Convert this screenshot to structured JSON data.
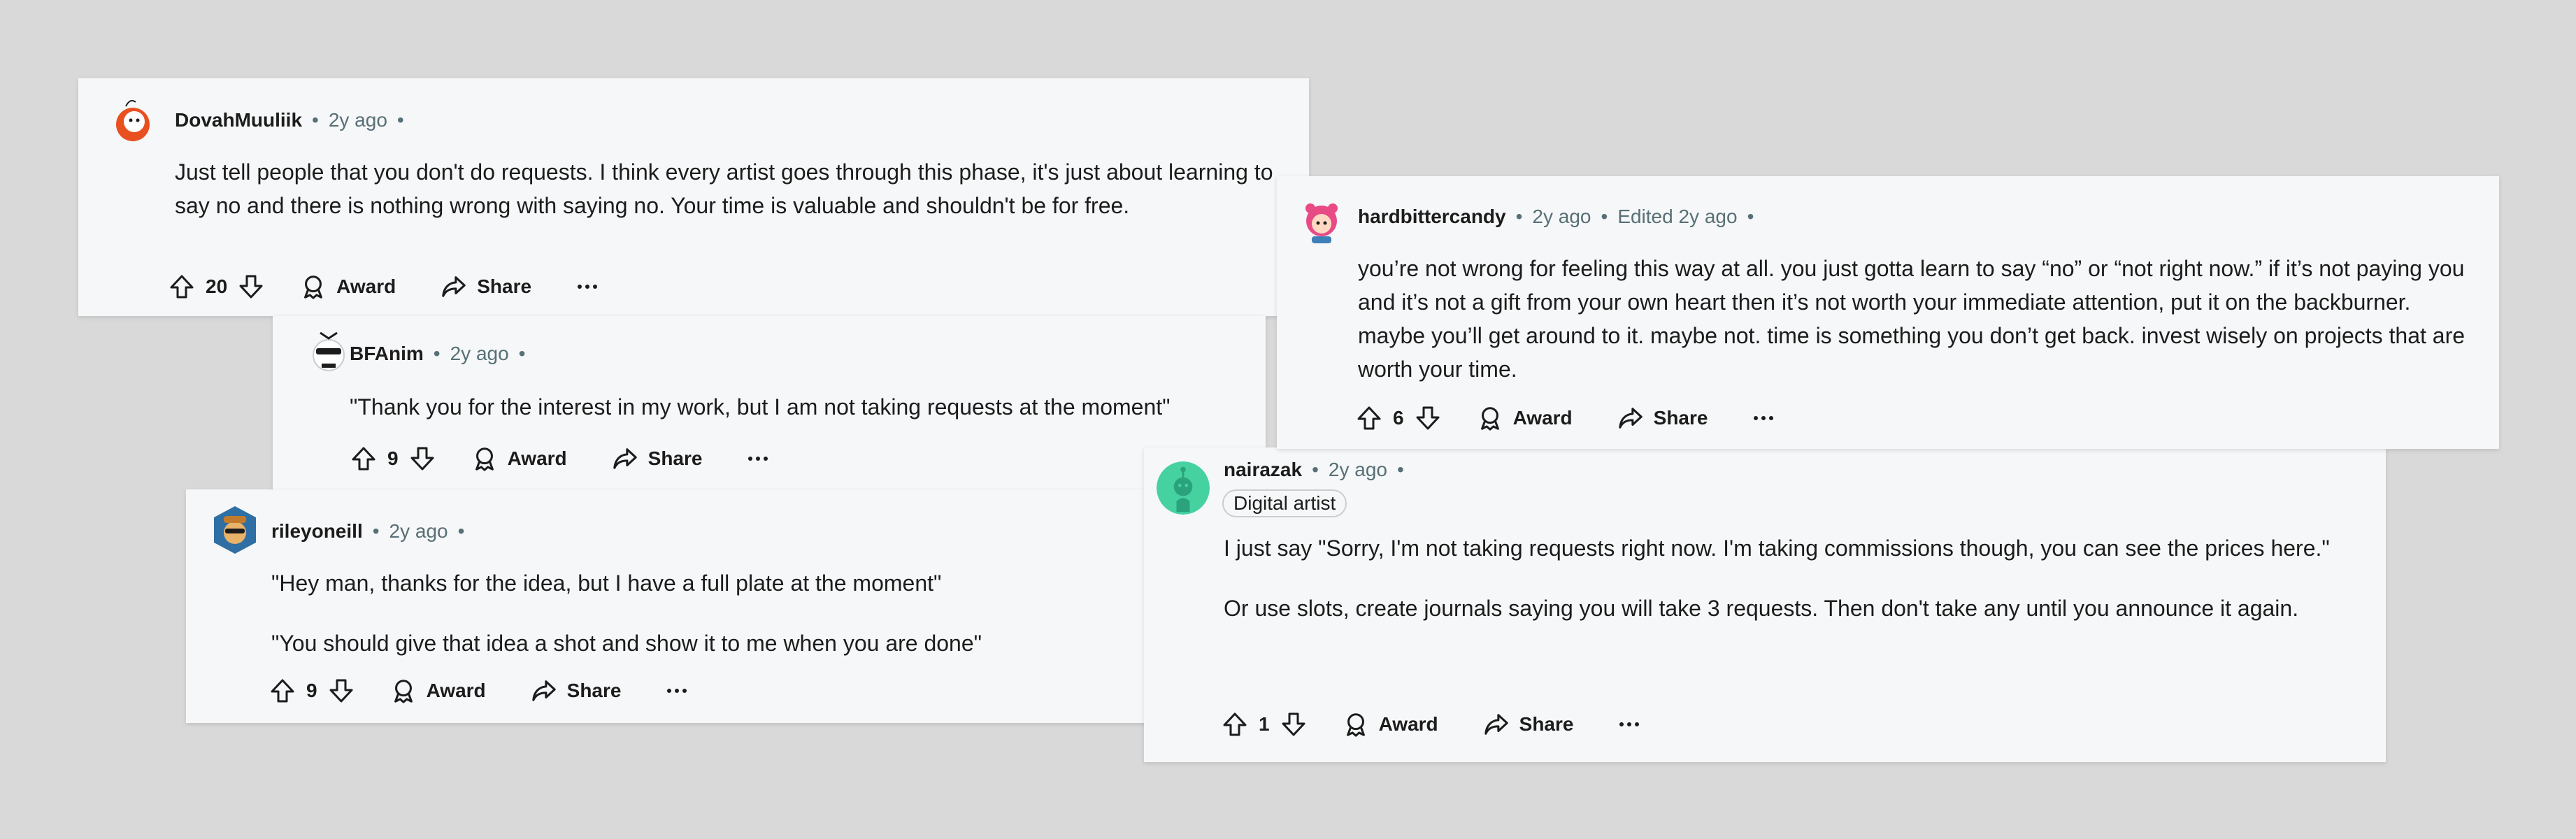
{
  "comments": [
    {
      "username": "DovahMuuliik",
      "time": "2y ago",
      "edited": "",
      "flair": "",
      "body": [
        "Just tell people that you don't do requests. I think every artist goes through this phase, it's just about learning to say no and there is nothing wrong with saying no. Your time is valuable and shouldn't be for free."
      ],
      "votes": "20",
      "award_label": "Award",
      "share_label": "Share"
    },
    {
      "username": "BFAnim",
      "time": "2y ago",
      "edited": "",
      "flair": "",
      "body": [
        "\"Thank you for the interest in my work, but I am not taking requests at the moment\""
      ],
      "votes": "9",
      "award_label": "Award",
      "share_label": "Share"
    },
    {
      "username": "rileyoneill",
      "time": "2y ago",
      "edited": "",
      "flair": "",
      "body": [
        "\"Hey man, thanks for the idea, but I have a full plate at the moment\"",
        "\"You should give that idea a shot and show it to me when you are done\""
      ],
      "votes": "9",
      "award_label": "Award",
      "share_label": "Share"
    },
    {
      "username": "hardbittercandy",
      "time": "2y ago",
      "edited": "Edited 2y ago",
      "flair": "",
      "body": [
        "you’re not wrong for feeling this way at all. you just gotta learn to say “no” or “not right now.” if it’s not paying you and it’s not a gift from your own heart then it’s not worth your immediate attention, put it on the backburner. maybe you’ll get around to it. maybe not. time is something you don’t get back. invest wisely on projects that are worth your time."
      ],
      "votes": "6",
      "award_label": "Award",
      "share_label": "Share"
    },
    {
      "username": "nairazak",
      "time": "2y ago",
      "edited": "",
      "flair": "Digital artist",
      "body": [
        "I just say \"Sorry, I'm not taking requests right now. I'm taking commissions though, you can see the prices here.\"",
        "Or use slots, create journals saying you will take 3 requests. Then don't take any until you announce it again."
      ],
      "votes": "1",
      "award_label": "Award",
      "share_label": "Share"
    }
  ],
  "separator": "•",
  "colors": {
    "background": "#d9d9d9",
    "card": "#f6f7f8",
    "meta": "#576f76"
  },
  "icons": [
    "upvote-icon",
    "downvote-icon",
    "award-icon",
    "share-icon",
    "more-icon"
  ]
}
